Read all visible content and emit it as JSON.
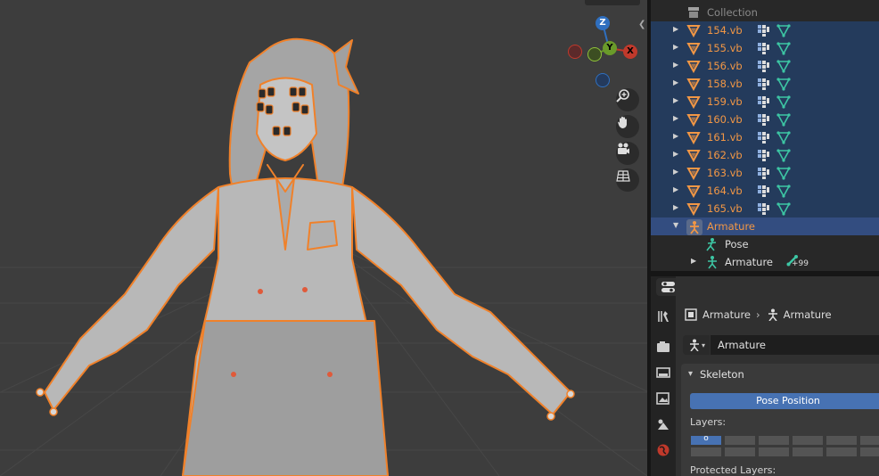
{
  "viewport": {
    "gizmo": {
      "z_label": "Z",
      "y_label": "Y",
      "x_label": "X"
    },
    "tools": [
      "zoom-icon",
      "hand-icon",
      "camera-icon",
      "grid-icon"
    ]
  },
  "outliner": {
    "collection_label": "Collection",
    "meshes": [
      "154.vb",
      "155.vb",
      "156.vb",
      "158.vb",
      "159.vb",
      "160.vb",
      "161.vb",
      "162.vb",
      "163.vb",
      "164.vb",
      "165.vb"
    ],
    "armature_label": "Armature",
    "pose_label": "Pose",
    "armature_data_label": "Armature",
    "bone_count": "99"
  },
  "properties": {
    "breadcrumb": {
      "object": "Armature",
      "data": "Armature"
    },
    "datablock_name": "Armature",
    "panel_title": "Skeleton",
    "pose_position_button": "Pose Position",
    "layers_label": "Layers:",
    "layer_active_marker": "o",
    "protected_layers_label": "Protected Layers:"
  },
  "colors": {
    "selection_outline": "#f0812a",
    "active_row": "#334d80",
    "selected_row": "#243b5c",
    "button_blue": "#4772b3",
    "mesh_label": "#f29745"
  }
}
